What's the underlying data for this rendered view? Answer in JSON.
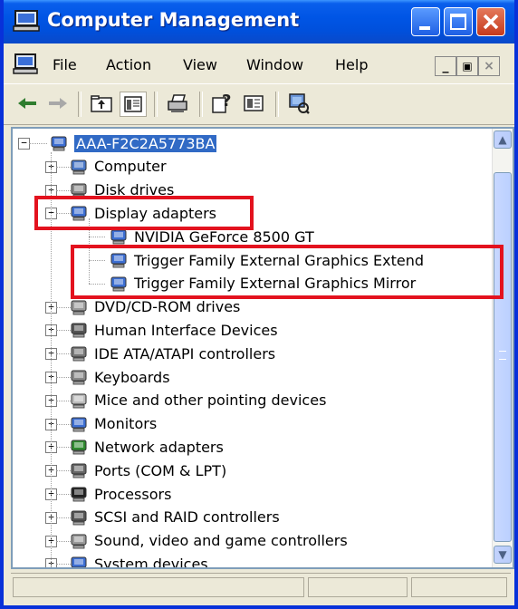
{
  "window": {
    "title": "Computer Management",
    "icon": "computer-management-icon",
    "controls": [
      "minimize",
      "maximize",
      "close"
    ],
    "title_color": "#0055E5"
  },
  "menubar": {
    "items": [
      "File",
      "Action",
      "View",
      "Window",
      "Help"
    ]
  },
  "toolbar": {
    "buttons": [
      "back-icon",
      "forward-icon",
      "up-folder-icon",
      "show-hide-tree-icon",
      "print-icon",
      "help-icon",
      "properties-icon",
      "scan-hardware-icon"
    ]
  },
  "tree": {
    "root": "AAA-F2C2A5773BA",
    "items": [
      {
        "label": "Computer",
        "icon": "computer-icon",
        "expanded": false
      },
      {
        "label": "Disk drives",
        "icon": "disk-drive-icon",
        "expanded": false
      },
      {
        "label": "Display adapters",
        "icon": "display-adapter-icon",
        "expanded": true,
        "children": [
          "NVIDIA GeForce 8500 GT",
          "Trigger Family External Graphics Extend",
          "Trigger Family External Graphics Mirror"
        ]
      },
      {
        "label": "DVD/CD-ROM drives",
        "icon": "dvd-drive-icon",
        "expanded": false
      },
      {
        "label": "Human Interface Devices",
        "icon": "hid-icon",
        "expanded": false
      },
      {
        "label": "IDE ATA/ATAPI controllers",
        "icon": "ide-controller-icon",
        "expanded": false
      },
      {
        "label": "Keyboards",
        "icon": "keyboard-icon",
        "expanded": false
      },
      {
        "label": "Mice and other pointing devices",
        "icon": "mouse-icon",
        "expanded": false
      },
      {
        "label": "Monitors",
        "icon": "monitor-icon",
        "expanded": false
      },
      {
        "label": "Network adapters",
        "icon": "network-adapter-icon",
        "expanded": false
      },
      {
        "label": "Ports (COM & LPT)",
        "icon": "port-icon",
        "expanded": false
      },
      {
        "label": "Processors",
        "icon": "processor-icon",
        "expanded": false
      },
      {
        "label": "SCSI and RAID controllers",
        "icon": "scsi-icon",
        "expanded": false
      },
      {
        "label": "Sound, video and game controllers",
        "icon": "sound-icon",
        "expanded": false
      },
      {
        "label": "System devices",
        "icon": "system-device-icon",
        "expanded": false
      }
    ]
  },
  "highlight_color": "#E3121E"
}
